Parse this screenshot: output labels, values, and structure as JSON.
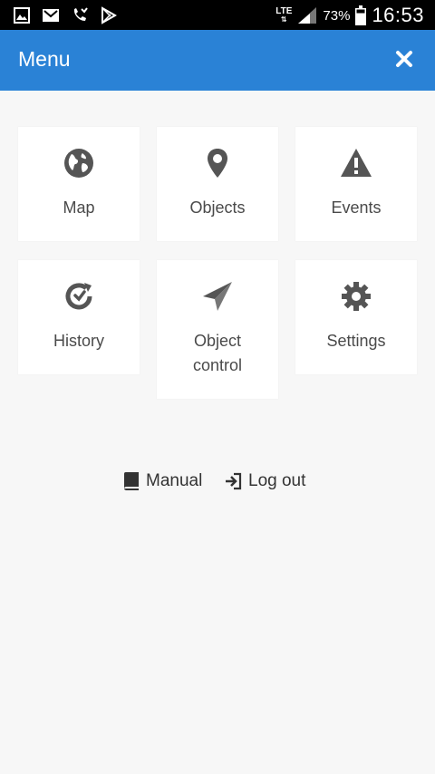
{
  "status_bar": {
    "network": "LTE",
    "battery": "73%",
    "time": "16:53",
    "left_icons": [
      "gallery-icon",
      "gmail-icon",
      "missed-call-icon",
      "play-store-icon"
    ]
  },
  "header": {
    "title": "Menu",
    "accent": "#2a82d6",
    "close_icon": "close-icon"
  },
  "menu": {
    "items": [
      {
        "label": "Map",
        "icon": "globe-icon"
      },
      {
        "label": "Objects",
        "icon": "map-pin-icon"
      },
      {
        "label": "Events",
        "icon": "warning-icon"
      },
      {
        "label": "History",
        "icon": "history-icon"
      },
      {
        "label": "Object control",
        "icon": "paper-plane-icon"
      },
      {
        "label": "Settings",
        "icon": "gear-icon"
      }
    ]
  },
  "footer_links": {
    "manual": {
      "label": "Manual",
      "icon": "book-icon"
    },
    "logout": {
      "label": "Log out",
      "icon": "sign-in-icon"
    }
  }
}
